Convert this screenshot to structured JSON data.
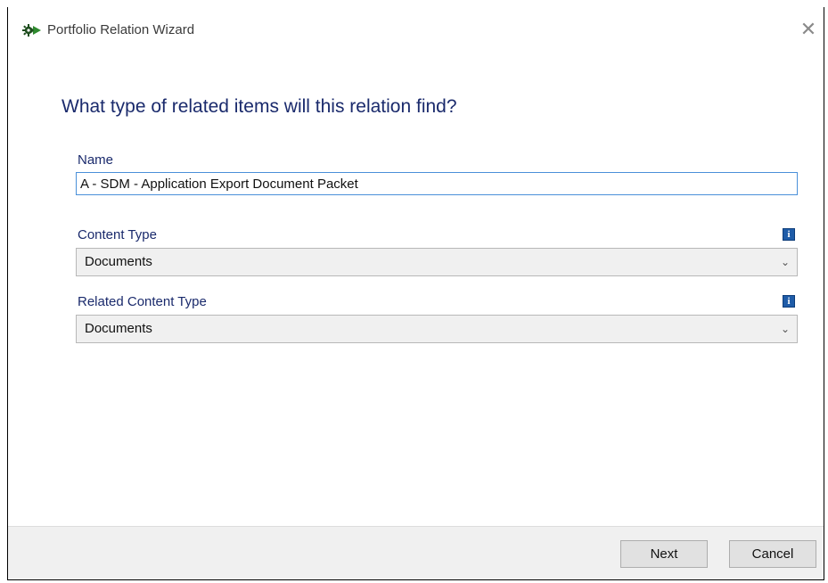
{
  "window": {
    "title": "Portfolio Relation Wizard",
    "close_glyph": "✕",
    "icon": "gear-arrows-icon"
  },
  "page": {
    "heading": "What type of related items will this relation find?"
  },
  "form": {
    "name": {
      "label": "Name",
      "value": "A - SDM - Application Export Document Packet"
    },
    "content_type": {
      "label": "Content Type",
      "selected": "Documents",
      "info_glyph": "i"
    },
    "related_content_type": {
      "label": "Related Content Type",
      "selected": "Documents",
      "info_glyph": "i"
    }
  },
  "footer": {
    "next_label": "Next",
    "cancel_label": "Cancel"
  },
  "colors": {
    "heading": "#1a2a6c",
    "info_icon": "#1f5ca8",
    "input_focus_border": "#4a90d9",
    "footer_bg": "#f0f0f0"
  }
}
